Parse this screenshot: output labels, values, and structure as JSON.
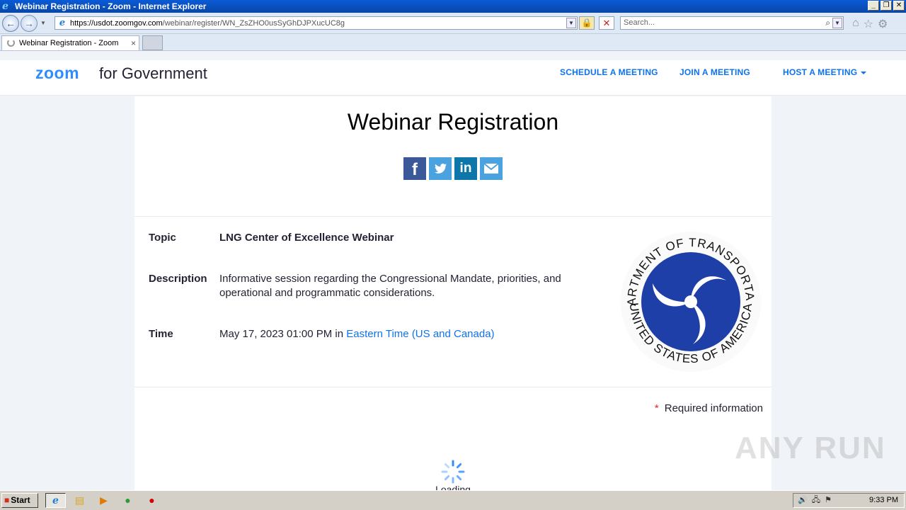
{
  "window": {
    "title": "Webinar Registration - Zoom - Internet Explorer",
    "minimize": "_",
    "restore": "❐",
    "close": "✕"
  },
  "browser": {
    "url_scheme_host": "https://usdot.zoomgov.com",
    "url_path": "/webinar/register/WN_ZsZHO0usSyGhDJPXucUC8g",
    "search_placeholder": "Search...",
    "tab_title": "Webinar Registration - Zoom",
    "tab_close": "×",
    "icons": {
      "back": "←",
      "forward": "→",
      "lock": "🔒",
      "stop": "✕",
      "search": "⌕",
      "home": "⌂",
      "favorites": "☆",
      "tools": "⚙"
    }
  },
  "header": {
    "logo": "zoom",
    "logo_sub": "for Government",
    "nav": {
      "schedule": "SCHEDULE A MEETING",
      "join": "JOIN A MEETING",
      "host": "HOST A MEETING"
    }
  },
  "page": {
    "title": "Webinar Registration",
    "share": {
      "facebook": "f",
      "linkedin": "in"
    },
    "details": {
      "topic_label": "Topic",
      "topic_value": "LNG Center of Excellence Webinar",
      "description_label": "Description",
      "description_value": "Informative session regarding the Congressional Mandate, priorities, and operational and programmatic considerations.",
      "time_label": "Time",
      "time_value": "May 17, 2023 01:00 PM in",
      "time_zone": "Eastern Time (US and Canada)"
    },
    "seal": {
      "top_text": "DEPARTMENT OF TRANSPORTATION",
      "bottom_text": "UNITED STATES OF AMERICA",
      "color": "#1e3ea8"
    },
    "required_marker": "*",
    "required_text": "Required information",
    "loading_text": "Loading"
  },
  "watermark": "ANY RUN",
  "taskbar": {
    "start": "Start",
    "clock": "9:33 PM"
  }
}
